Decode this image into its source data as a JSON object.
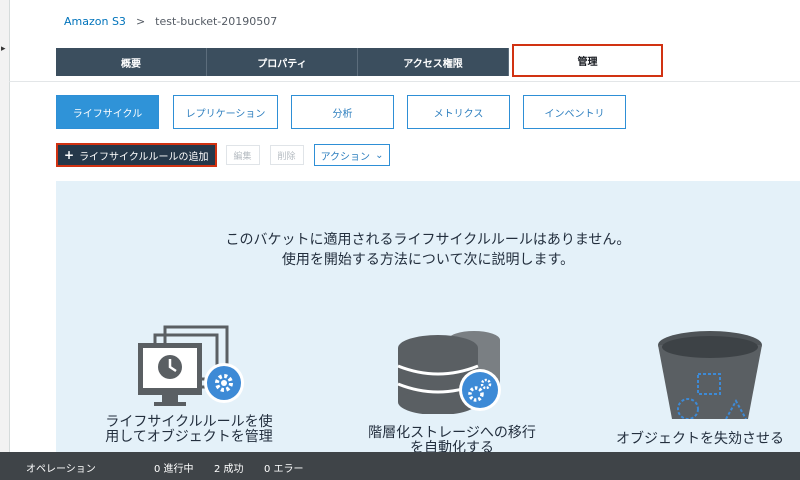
{
  "breadcrumb": {
    "root": "Amazon S3",
    "separator": ">",
    "bucket": "test-bucket-20190507"
  },
  "tabs": [
    {
      "label": "概要"
    },
    {
      "label": "プロパティ"
    },
    {
      "label": "アクセス権限"
    },
    {
      "label": "管理",
      "active": true
    }
  ],
  "subtabs": [
    {
      "label": "ライフサイクル",
      "active": true
    },
    {
      "label": "レプリケーション"
    },
    {
      "label": "分析"
    },
    {
      "label": "メトリクス"
    },
    {
      "label": "インベントリ"
    }
  ],
  "toolbar": {
    "add_rule_label": "ライフサイクルルールの追加",
    "edit_label": "編集",
    "delete_label": "削除",
    "actions_label": "アクション",
    "actions_caret": "⌄"
  },
  "empty_state": {
    "line1": "このバケットに適用されるライフサイクルルールはありません。",
    "line2": "使用を開始する方法について次に説明します。"
  },
  "features": [
    {
      "icon": "monitor-clock-gear-icon",
      "caption_line1": "ライフサイクルルールを使",
      "caption_line2": "用してオブジェクトを管理"
    },
    {
      "icon": "database-storage-gear-icon",
      "caption_line1": "階層化ストレージへの移行",
      "caption_line2": "を自動化する"
    },
    {
      "icon": "bucket-expire-icon",
      "caption_line1": "オブジェクトを失効させる",
      "caption_line2": ""
    }
  ],
  "statusbar": {
    "operations_label": "オペレーション",
    "in_progress": "0 進行中",
    "success": "2 成功",
    "errors": "0 エラー"
  },
  "colors": {
    "tab_bg": "#3b4e5e",
    "accent_blue": "#2f93d8",
    "highlight_red": "#d13212",
    "panel_bg": "#e4f1f9",
    "statusbar_bg": "#3f4448",
    "icon_gray": "#5a5f63",
    "gear_blue": "#3d8ad6"
  }
}
